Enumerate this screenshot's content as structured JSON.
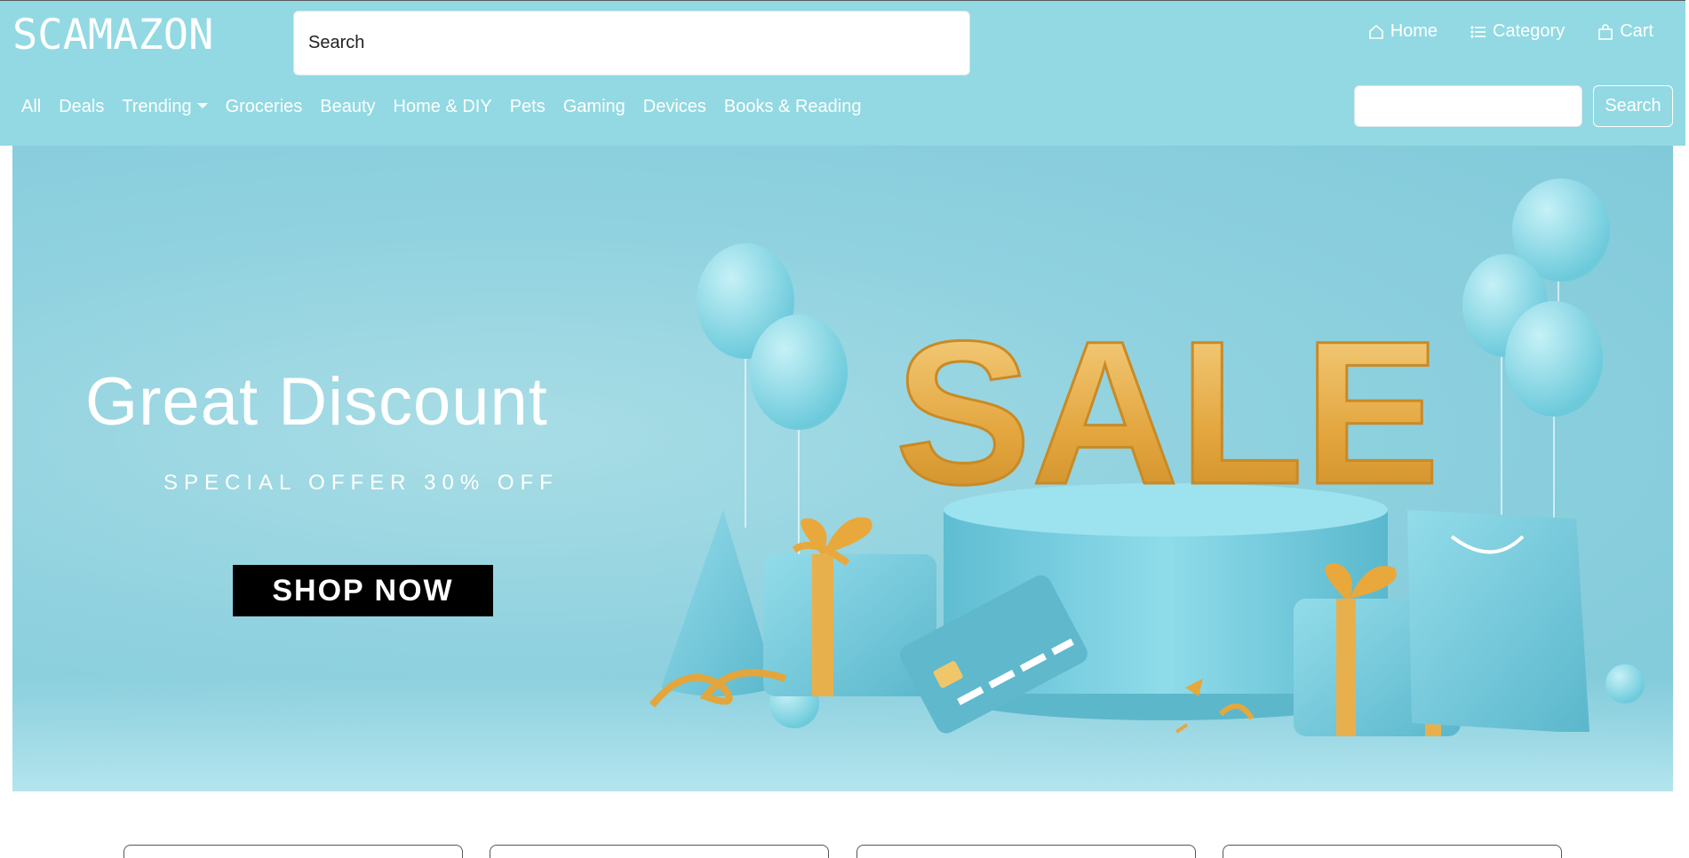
{
  "header": {
    "logo": "SCAMAZON",
    "search_placeholder": "Search",
    "top_nav": [
      {
        "label": "Home",
        "icon": "home-icon"
      },
      {
        "label": "Category",
        "icon": "list-icon"
      },
      {
        "label": "Cart",
        "icon": "shopping-bag-icon"
      }
    ],
    "categories": [
      "All",
      "Deals",
      "Trending",
      "Groceries",
      "Beauty",
      "Home & DIY",
      "Pets",
      "Gaming",
      "Devices",
      "Books & Reading"
    ],
    "search_button": "Search"
  },
  "hero": {
    "title": "Great Discount",
    "subtitle": "SPECIAL OFFER 30% OFF",
    "cta": "SHOP NOW",
    "sale_word": "SALE"
  },
  "colors": {
    "header_bg": "#92d9e3",
    "hero_bg": "#8fd1df",
    "accent_gold": "#e6a83a",
    "cta_bg": "#000000"
  }
}
